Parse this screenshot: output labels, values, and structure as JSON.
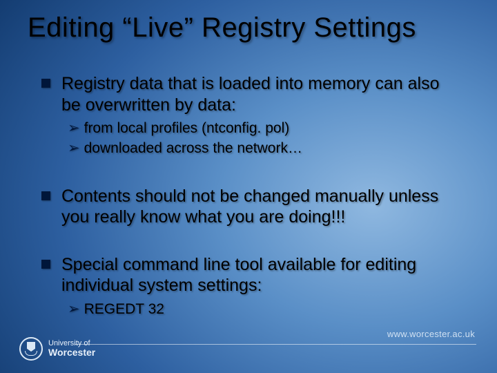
{
  "title": "Editing “Live” Registry Settings",
  "bullets": [
    {
      "text": "Registry data that is loaded into memory can also be overwritten by data:",
      "sub": [
        "from local profiles (ntconfig. pol)",
        "downloaded across the network…"
      ]
    },
    {
      "text": "Contents should not be changed manually unless you really know what you are doing!!!",
      "sub": []
    },
    {
      "text": "Special command line tool available for editing individual system settings:",
      "sub": [
        "REGEDT 32"
      ]
    }
  ],
  "footer": {
    "url": "www.worcester.ac.uk",
    "logo_line1": "University of",
    "logo_line2": "Worcester"
  }
}
